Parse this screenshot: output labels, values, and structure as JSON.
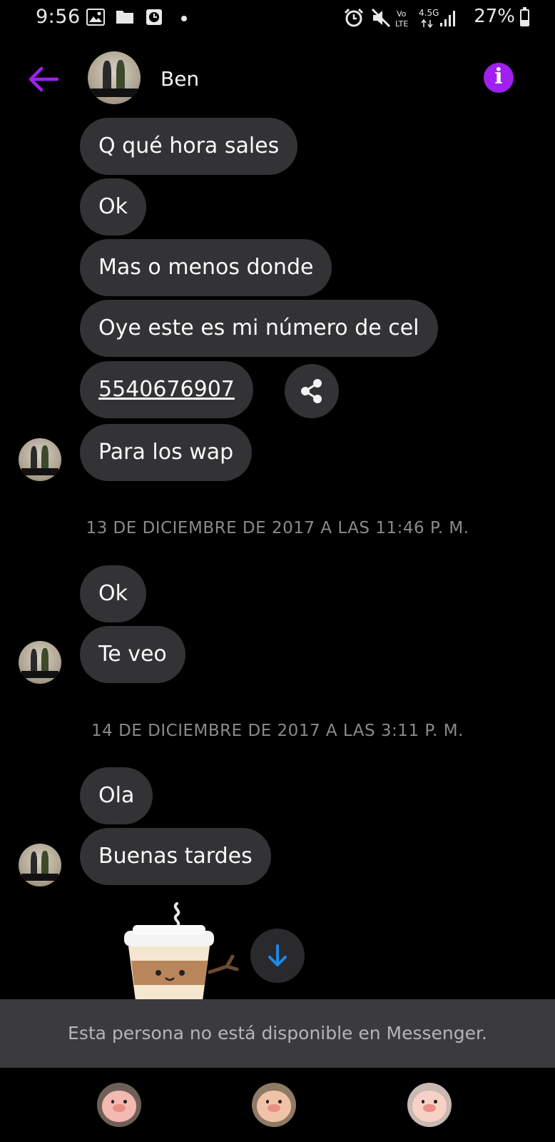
{
  "status_bar": {
    "time": "9:56",
    "network": "4.5G",
    "battery_percent": "27%",
    "icons": [
      "gallery-icon",
      "folder-icon",
      "clock-icon",
      "dot-icon",
      "alarm-icon",
      "mute-icon",
      "volte-icon",
      "signal-icon",
      "battery-icon"
    ]
  },
  "header": {
    "contact_name": "Ben",
    "back_icon": "arrow-left-icon",
    "info_icon": "info-icon",
    "accent_color": "#a020f0"
  },
  "messages": [
    {
      "text": "Q qué hora sales"
    },
    {
      "text": "Ok"
    },
    {
      "text": "Mas o menos donde"
    },
    {
      "text": "Oye este es mi número de cel"
    },
    {
      "text": "5540676907",
      "is_link": true
    },
    {
      "text": "Para los wap"
    }
  ],
  "timestamp_1": "13 DE DICIEMBRE DE 2017 A LAS 11:46 P. M.",
  "messages_2": [
    {
      "text": "Ok"
    },
    {
      "text": "Te veo"
    }
  ],
  "timestamp_2": "14 DE DICIEMBRE DE 2017 A LAS 3:11 P. M.",
  "messages_3": [
    {
      "text": "Ola"
    },
    {
      "text": "Buenas tardes"
    }
  ],
  "sticker": {
    "name": "coffee-cup-sticker"
  },
  "scroll_down_icon": "arrow-down-icon",
  "notice": "Esta persona no está disponible en Messenger.",
  "reactions": [
    "pig-sticker-1",
    "pig-sticker-2",
    "pig-sticker-3"
  ],
  "colors": {
    "bubble": "#333336",
    "background": "#000000",
    "timestamp": "#8a8a8e",
    "notice_bg": "#3b3b3e",
    "jump_arrow": "#1e88e5"
  }
}
